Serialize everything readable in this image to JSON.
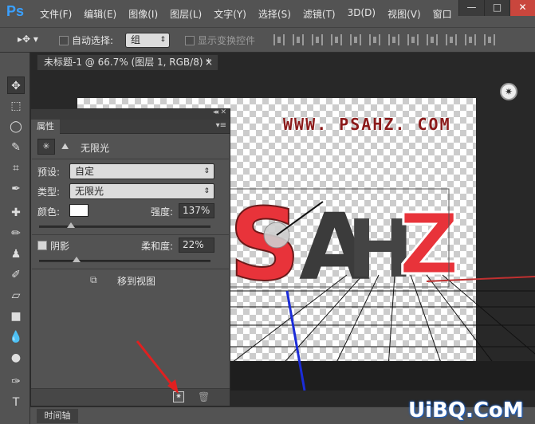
{
  "app": {
    "logo": "Ps"
  },
  "menu": [
    "文件(F)",
    "编辑(E)",
    "图像(I)",
    "图层(L)",
    "文字(Y)",
    "选择(S)",
    "滤镜(T)",
    "3D(D)",
    "视图(V)",
    "窗口"
  ],
  "window_controls": {
    "minimize": "—",
    "maximize": "□",
    "close": "✕"
  },
  "options": {
    "auto_select_label": "自动选择:",
    "auto_select_value": "组",
    "show_transform_label": "显示变换控件"
  },
  "document_tab": {
    "title": "未标题-1 @ 66.7% (图层 1, RGB/8) *",
    "close": "×"
  },
  "canvas": {
    "watermark": "WWW. PSAHZ. COM",
    "letters": [
      "S",
      "A",
      "H",
      "Z"
    ]
  },
  "properties": {
    "panel_title": "属性",
    "light_type_title": "无限光",
    "preset_label": "预设:",
    "preset_value": "自定",
    "type_label": "类型:",
    "type_value": "无限光",
    "color_label": "颜色:",
    "intensity_label": "强度:",
    "intensity_value": "137%",
    "shadow_label": "阴影",
    "shadow_checked": true,
    "softness_label": "柔和度:",
    "softness_value": "22%",
    "move_to_view_label": "移到视图"
  },
  "timeline": {
    "label": "时间轴"
  },
  "site_mark": "UiBQ.CoM",
  "colors": {
    "accent": "#3aa0ff",
    "arrow": "#e02020",
    "axis_blue": "#1b2cd8",
    "letter_red": "#e8333a"
  }
}
